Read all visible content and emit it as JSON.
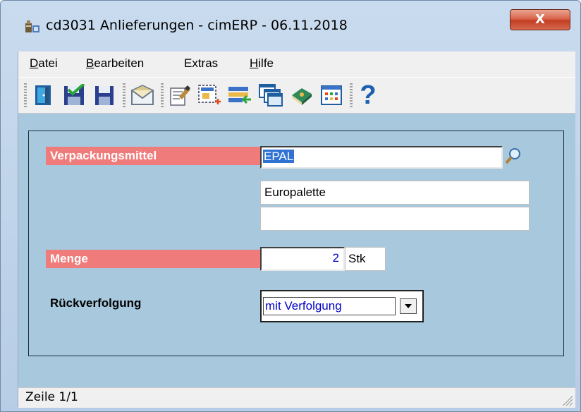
{
  "window": {
    "title": "cd3031 Anlieferungen - cimERP - 06.11.2018",
    "close_symbol": "X"
  },
  "menu": [
    {
      "label": "Datei",
      "accel": "D",
      "rest": "atei"
    },
    {
      "label": "Bearbeiten",
      "accel": "B",
      "rest": "earbeiten"
    },
    {
      "label": "Extras",
      "accel": "",
      "rest": "Extras"
    },
    {
      "label": "Hilfe",
      "accel": "H",
      "rest": "ilfe"
    }
  ],
  "toolbar": {
    "buttons": [
      "exit-door-icon",
      "save-check-icon",
      "save-icon",
      "mail-icon",
      "edit-icon",
      "new-record-icon",
      "import-icon",
      "windows-icon",
      "book-icon",
      "grid-icon",
      "help-icon"
    ],
    "help_symbol": "?"
  },
  "form": {
    "verpackungsmittel_label": "Verpackungsmittel",
    "verpackungsmittel_value": "EPAL",
    "description_value": "Europalette",
    "description2_value": "",
    "menge_label": "Menge",
    "menge_value": "2",
    "menge_unit": "Stk",
    "rueckverfolgung_label": "Rückverfolgung",
    "rueckverfolgung_value": "mit Verfolgung"
  },
  "status": {
    "text": "Zeile 1/1"
  },
  "colors": {
    "label_red": "#f07b7b",
    "form_bg": "#a7c8dd",
    "selection_blue": "#3173d3",
    "value_blue": "#0000c8"
  }
}
